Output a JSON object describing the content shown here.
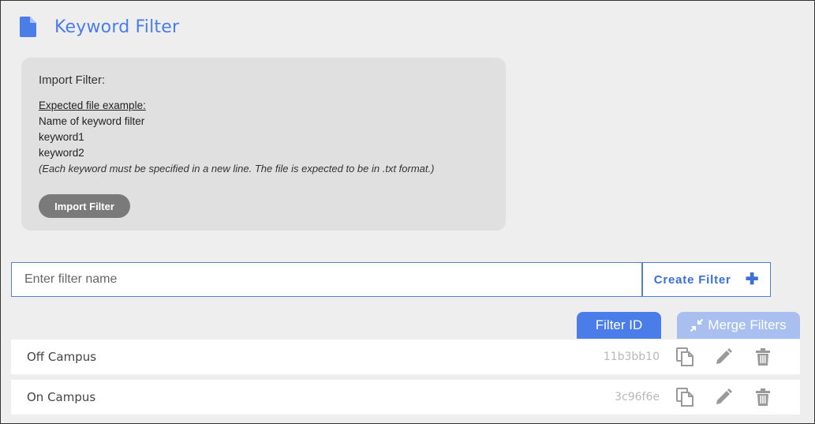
{
  "header": {
    "title": "Keyword Filter",
    "icon": "document-icon",
    "accent_color": "#4a7de8"
  },
  "import_panel": {
    "heading": "Import Filter:",
    "example_label": "Expected file example:",
    "example_lines": [
      "Name of keyword filter",
      "keyword1",
      "keyword2"
    ],
    "note": "(Each keyword must be specified in a new line. The file is expected to be in .txt format.)",
    "button_label": "Import Filter"
  },
  "create": {
    "placeholder": "Enter filter name",
    "value": "",
    "button_label": "Create Filter",
    "button_icon": "plus-icon"
  },
  "tabs": {
    "filter_id_label": "Filter ID",
    "merge_label": "Merge Filters",
    "merge_icon": "compress-arrows-icon"
  },
  "filters": [
    {
      "name": "Off Campus",
      "id": "11b3bb10"
    },
    {
      "name": "On Campus",
      "id": "3c96f6e"
    }
  ],
  "row_actions": [
    "copy-icon",
    "pencil-icon",
    "trash-icon"
  ]
}
